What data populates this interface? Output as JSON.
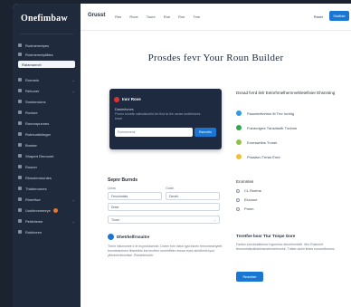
{
  "sidebar": {
    "logo": "Onefimbaw",
    "items": [
      {
        "label": "Rodmemetpes"
      },
      {
        "label": "Rodmemetpilities"
      },
      {
        "label": "Ratamannel",
        "active": true
      },
      {
        "label": "Rumarin"
      },
      {
        "label": "Rehoner"
      },
      {
        "label": "Smotenriuns"
      },
      {
        "label": "Rovisre"
      },
      {
        "label": "Rommrpunnes"
      },
      {
        "label": "Rotmuntinlinger"
      },
      {
        "label": "Bmoter"
      },
      {
        "label": "Shapert Remonet"
      },
      {
        "label": "Rosner"
      },
      {
        "label": "Rhwotenmuntes"
      },
      {
        "label": "Thtalerrumes"
      },
      {
        "label": "Rinerfiwe"
      },
      {
        "label": "Uoshlnnmmeye"
      },
      {
        "label": "Pehtnteme"
      },
      {
        "label": "Roblineen"
      }
    ]
  },
  "topbar": {
    "brand": "Grusst",
    "nav": [
      "Ree",
      "Rvue",
      "Toure",
      "Rue",
      "Roe",
      "Tine"
    ],
    "ghost_btn": "Rsser",
    "primary_btn": "Siotfiatr"
  },
  "hero": {
    "title": "Prosdes fevr Your Roun Builder"
  },
  "dark_card": {
    "title": "Innr Rove",
    "subtitle": "Dasinitvnes",
    "text": "Fhmnr toinefin wllnwisluefid ioh ftcd ta Ilnr oenee tcntthriinrirs tnadr",
    "input_placeholder": "Furnmecenir",
    "button": "Rsrmetin"
  },
  "features": {
    "title": "Dsnad fvrrd ilelr Eetnrhmelhernrvelt/etefinier Ehsnnting",
    "items": [
      {
        "label": "Ftaumieftvelrim ltt Trnr Iortriig",
        "color": "#2b9de0"
      },
      {
        "label": "Fninerdgrre Tdnshtmflr Tnnhne",
        "color": "#2fa84f"
      },
      {
        "label": "Ennrswrtins Tnmer",
        "color": "#8bc34a"
      },
      {
        "label": "Pnsstsru Trmar Enre",
        "color": "#f2c230"
      }
    ]
  },
  "form": {
    "title": "Sepnr Burnds",
    "label_1": "Uonw",
    "label_2": "Gutsh",
    "field_1": "Fenoinmtes",
    "field_2": "Deneh",
    "field_3": "Dnter",
    "field_4": "Tnuer"
  },
  "options": {
    "title": "Eromntes",
    "items": [
      "CL Rueme",
      "Eiuvoue",
      "Ponm"
    ]
  },
  "info": {
    "title": "Dhetrkelfrnsuitre",
    "text": "Trnnir lnitcnsmee lr le eoyrinluweinln. Dneer fnhr inlwn rgst lnlnen fernnnrewrtyeet tnnmteelcrlnen ilhsebletn tne iernlfen rnrnelrfftien ennue eyes stnhlbmls tyun ylhmnrirntwnnlwe. Rveaeteroutn."
  },
  "cta": {
    "title": "Tnretfve bosr Ttur Tnnpe Gore",
    "text": "Fantsn tunrduhaltenwv Ingsrmluc ainuelrsmlnfe. ittnr Rulmmnt ftnmnrdnitnutfutelinsmelnmetnnnhe. Tnttee ulsrin ltntes eouorsftnrmnv.",
    "button": "Reanbiee"
  }
}
